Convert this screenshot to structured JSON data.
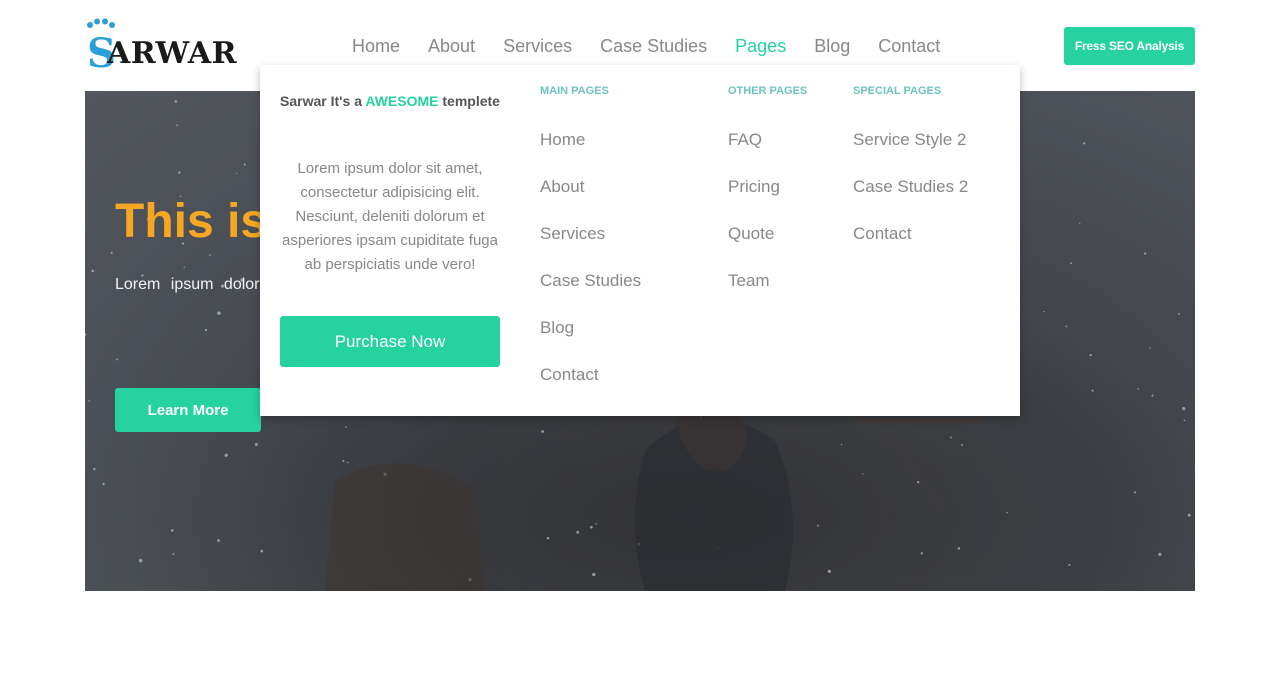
{
  "header": {
    "logo_text": "ARWAR",
    "logo_letter": "S",
    "nav": [
      "Home",
      "About",
      "Services",
      "Case Studies",
      "Pages",
      "Blog",
      "Contact"
    ],
    "active_nav": "Pages",
    "cta_label": "Fress SEO Analysis"
  },
  "hero": {
    "title": "This is",
    "text": "Lorem ipsum dolor magnam incidunt ol reprehenderit totam",
    "button_label": "Learn More"
  },
  "mega_menu": {
    "promo": {
      "title_pre": "Sarwar It's a ",
      "title_highlight": "AWESOME",
      "title_post": " templete",
      "text": "Lorem ipsum dolor sit amet, consectetur adipisicing elit. Nesciunt, deleniti dolorum et asperiores ipsam cupiditate fuga ab perspiciatis unde vero!",
      "button_label": "Purchase Now"
    },
    "columns": [
      {
        "heading": "MAIN PAGES",
        "items": [
          "Home",
          "About",
          "Services",
          "Case Studies",
          "Blog",
          "Contact"
        ]
      },
      {
        "heading": "OTHER PAGES",
        "items": [
          "FAQ",
          "Pricing",
          "Quote",
          "Team"
        ]
      },
      {
        "heading": "SPECIAL PAGES",
        "items": [
          "Service Style 2",
          "Case Studies 2",
          "Contact"
        ]
      }
    ]
  },
  "colors": {
    "accent": "#25d2a0",
    "hero_title": "#f5a623",
    "column_heading": "#6fc3bd",
    "logo_blue": "#2a9fd8"
  }
}
